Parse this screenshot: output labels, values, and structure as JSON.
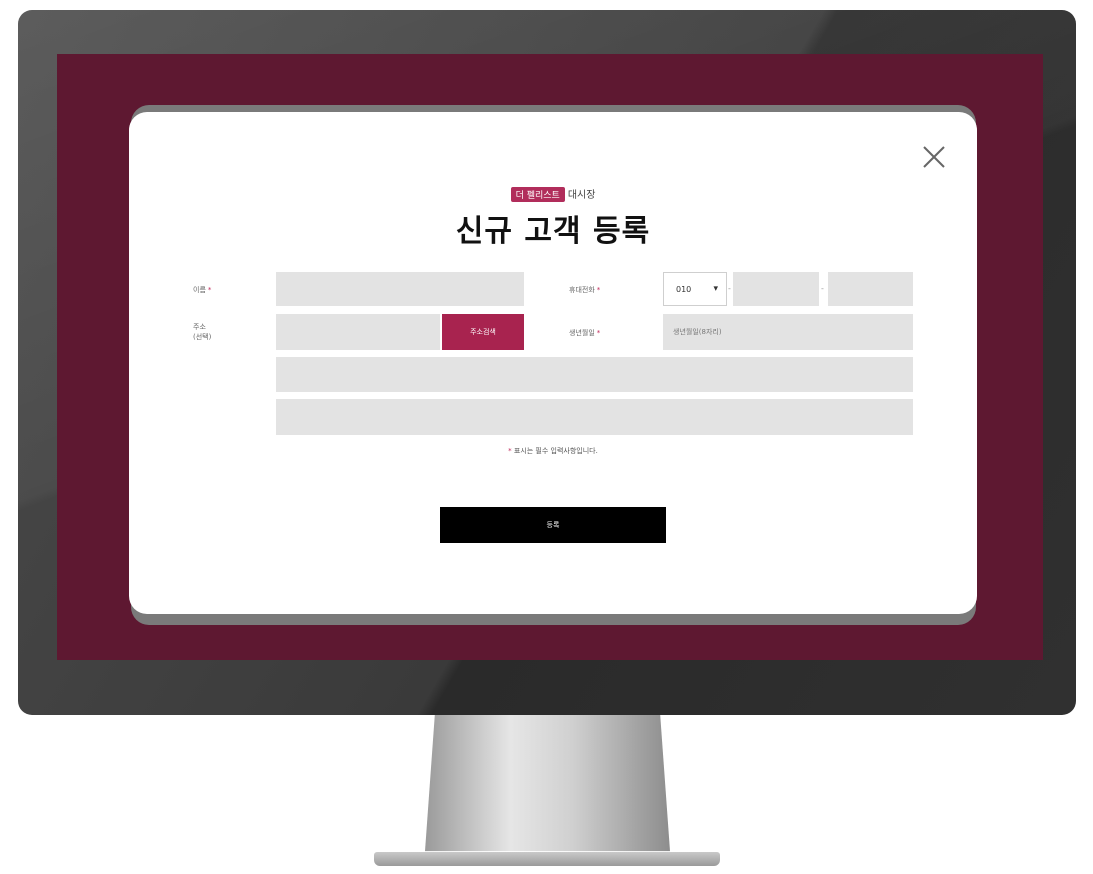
{
  "brand": {
    "badge": "더 펠리스트",
    "suffix": "대시장"
  },
  "title": "신규 고객 등록",
  "form": {
    "name_label": "이름",
    "phone_label": "휴대전화",
    "phone_prefix": "010",
    "phone_separator": "-",
    "address_label": "주소",
    "address_sublabel": "(선택)",
    "address_search_button": "주소검색",
    "birthdate_label": "생년월일",
    "birthdate_placeholder": "생년월일(8자리)",
    "required_mark": "*"
  },
  "note": {
    "mark": "*",
    "text": "표시는 필수 입력사항입니다."
  },
  "submit_label": "등록",
  "colors": {
    "screen_bg": "#5e1831",
    "accent": "#a8234f",
    "submit_bg": "#000000"
  }
}
